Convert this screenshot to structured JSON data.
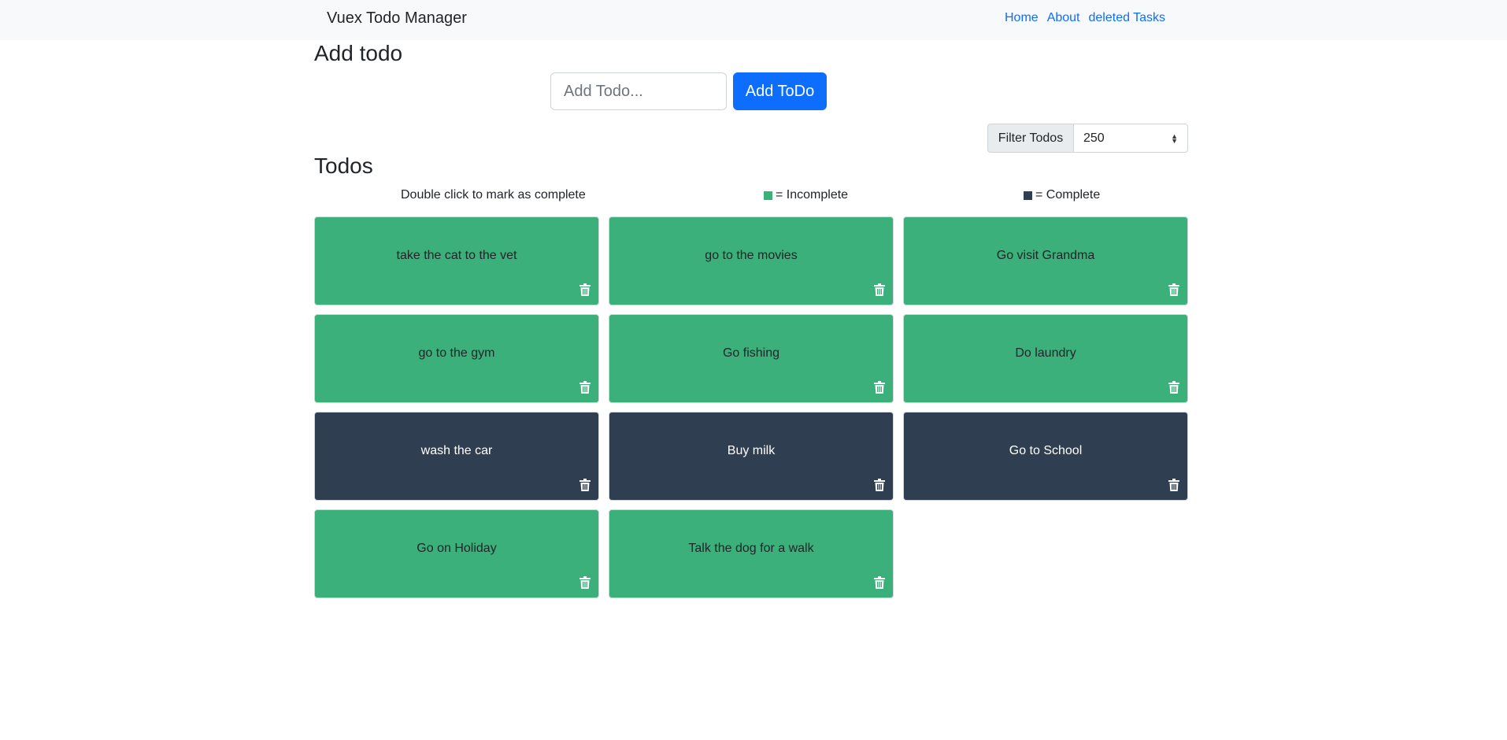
{
  "navbar": {
    "brand": "Vuex Todo Manager",
    "links": [
      "Home",
      "About",
      "deleted Tasks"
    ]
  },
  "add": {
    "title": "Add todo",
    "placeholder": "Add Todo...",
    "value": "",
    "button_label": "Add ToDo"
  },
  "filter": {
    "label": "Filter Todos",
    "selected": "250"
  },
  "todos_section": {
    "title": "Todos",
    "legend": {
      "hint": "Double click to mark as complete",
      "incomplete_label": "= Incomplete",
      "complete_label": "= Complete",
      "incomplete_color": "#3bb07a",
      "complete_color": "#2f3e51"
    },
    "items": [
      {
        "title": "take the cat to the vet",
        "completed": false
      },
      {
        "title": "go to the movies",
        "completed": false
      },
      {
        "title": "Go visit Grandma",
        "completed": false
      },
      {
        "title": "go to the gym",
        "completed": false
      },
      {
        "title": "Go fishing",
        "completed": false
      },
      {
        "title": "Do laundry",
        "completed": false
      },
      {
        "title": "wash the car",
        "completed": true
      },
      {
        "title": "Buy milk",
        "completed": true
      },
      {
        "title": "Go to School",
        "completed": true
      },
      {
        "title": "Go on Holiday",
        "completed": false
      },
      {
        "title": "Talk the dog for a walk",
        "completed": false
      }
    ],
    "delete_icon": "trash-icon"
  }
}
